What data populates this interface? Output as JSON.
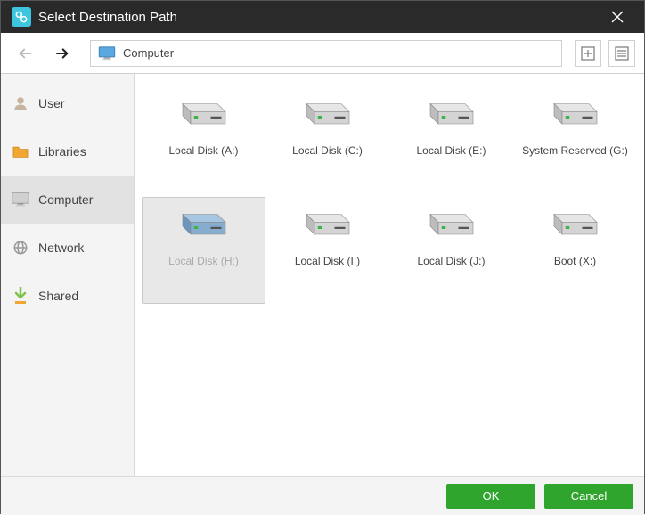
{
  "window": {
    "title": "Select Destination Path"
  },
  "breadcrumb": {
    "location": "Computer"
  },
  "sidebar": {
    "items": [
      {
        "label": "User",
        "iconColor": "#c7b49e"
      },
      {
        "label": "Libraries",
        "iconColor": "#f0a732"
      },
      {
        "label": "Computer",
        "iconColor": "#8f8f8f"
      },
      {
        "label": "Network",
        "iconColor": "#8f8f8f"
      },
      {
        "label": "Shared",
        "iconColor": "#7fc24a"
      }
    ],
    "selectedIndex": 2
  },
  "drives": [
    {
      "label": "Local Disk (A:)",
      "selected": false,
      "color": "gray"
    },
    {
      "label": "Local Disk (C:)",
      "selected": false,
      "color": "gray"
    },
    {
      "label": "Local Disk (E:)",
      "selected": false,
      "color": "gray"
    },
    {
      "label": "System Reserved (G:)",
      "selected": false,
      "color": "gray"
    },
    {
      "label": "Local Disk (H:)",
      "selected": true,
      "color": "blue"
    },
    {
      "label": "Local Disk (I:)",
      "selected": false,
      "color": "gray"
    },
    {
      "label": "Local Disk (J:)",
      "selected": false,
      "color": "gray"
    },
    {
      "label": "Boot (X:)",
      "selected": false,
      "color": "gray"
    }
  ],
  "buttons": {
    "ok": "OK",
    "cancel": "Cancel"
  }
}
